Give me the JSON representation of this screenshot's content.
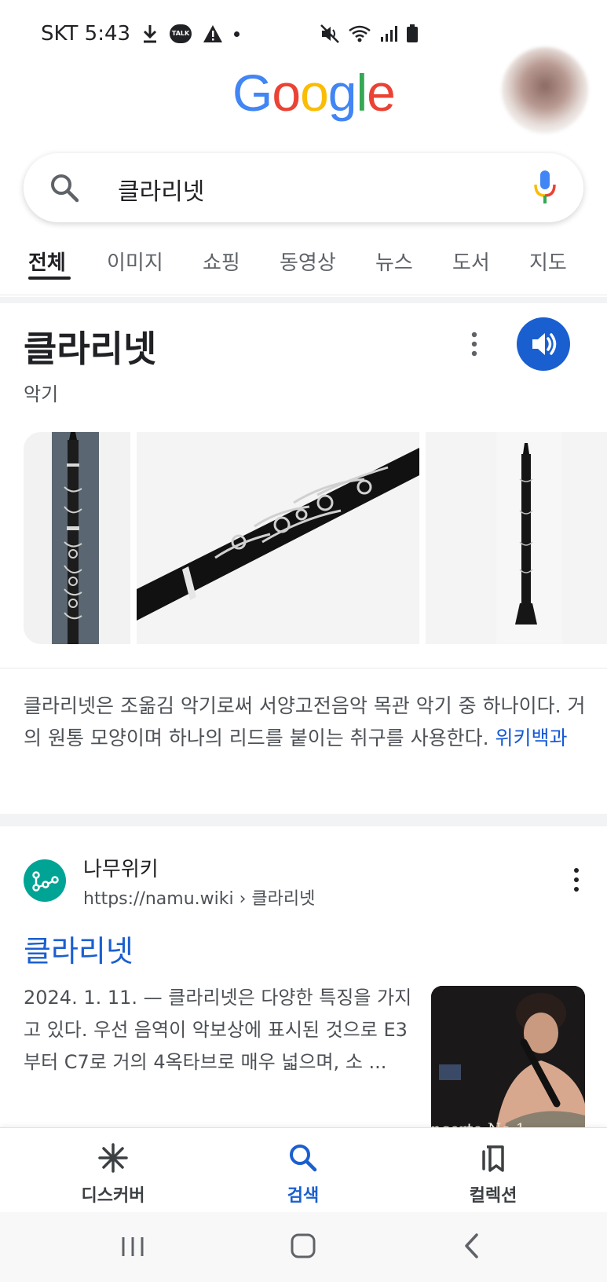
{
  "status_bar": {
    "carrier_time": "SKT 5:43",
    "talk_badge": "TALK"
  },
  "google_logo": {
    "letters": [
      "G",
      "o",
      "o",
      "g",
      "l",
      "e"
    ],
    "colors": [
      "#4285F4",
      "#EA4335",
      "#FBBC05",
      "#4285F4",
      "#34A853",
      "#EA4335"
    ]
  },
  "search": {
    "query": "클라리넷"
  },
  "tabs": [
    {
      "label": "전체",
      "active": true
    },
    {
      "label": "이미지"
    },
    {
      "label": "쇼핑"
    },
    {
      "label": "동영상"
    },
    {
      "label": "뉴스"
    },
    {
      "label": "도서"
    },
    {
      "label": "지도"
    }
  ],
  "knowledge_panel": {
    "title": "클라리넷",
    "subtitle": "악기",
    "description": "클라리넷은 조옮김 악기로써 서양고전음악 목관 악기 중 하나이다. 거의 원통 모양이며 하나의 리드를 붙이는 취구를 사용한다.",
    "source_link": "위키백과"
  },
  "result": {
    "site_name": "나무위키",
    "url": "https://namu.wiki › 클라리넷",
    "title": "클라리넷",
    "snippet": "2024. 1. 11. — 클라리넷은 다양한 특징을 가지고 있다. 우선 음역이 악보상에 표시된 것으로 E3부터 C7로 거의 4옥타브로 매우 넓으며, 소 ...",
    "thumbnail_caption": "ncerto No.1"
  },
  "bottom_nav": [
    {
      "label": "디스커버",
      "icon": "asterisk-icon"
    },
    {
      "label": "검색",
      "icon": "search-icon",
      "active": true
    },
    {
      "label": "컬렉션",
      "icon": "bookmarks-icon"
    }
  ],
  "colors": {
    "accent_blue": "#1a5fd0",
    "link_blue": "#1558d6",
    "namu_green": "#00a495"
  }
}
